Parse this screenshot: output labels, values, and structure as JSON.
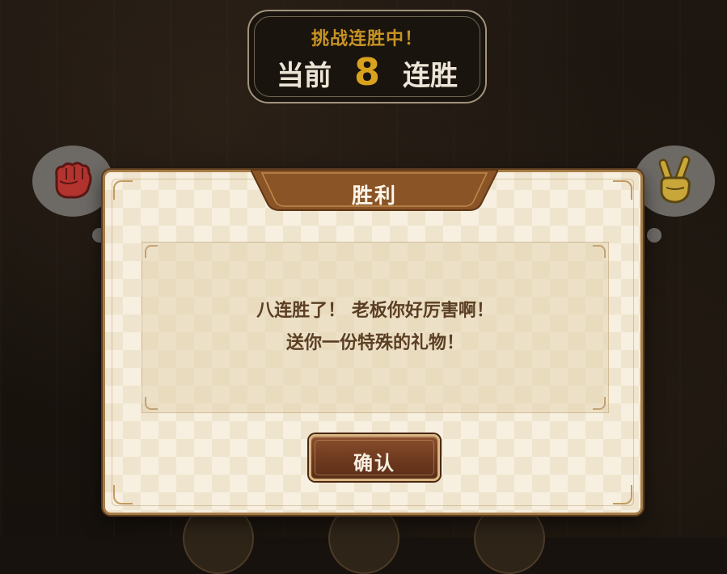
{
  "streak": {
    "challenge_label": "挑战连胜中！",
    "current_prefix": "当前",
    "count": "8",
    "suffix": "连胜"
  },
  "opponent": {
    "left_hand_icon": "fist-icon",
    "right_hand_icon": "victory-hand-icon"
  },
  "dialog": {
    "title": "胜利",
    "message_line_1": "八连胜了！ 老板你好厉害啊！",
    "message_line_2": "送你一份特殊的礼物！",
    "confirm_label": "确认"
  },
  "colors": {
    "gold_accent": "#d9a21e",
    "title_tab": "#8a5427",
    "button": "#6e3a1f",
    "dialog_bg": "#f7f0e0"
  }
}
